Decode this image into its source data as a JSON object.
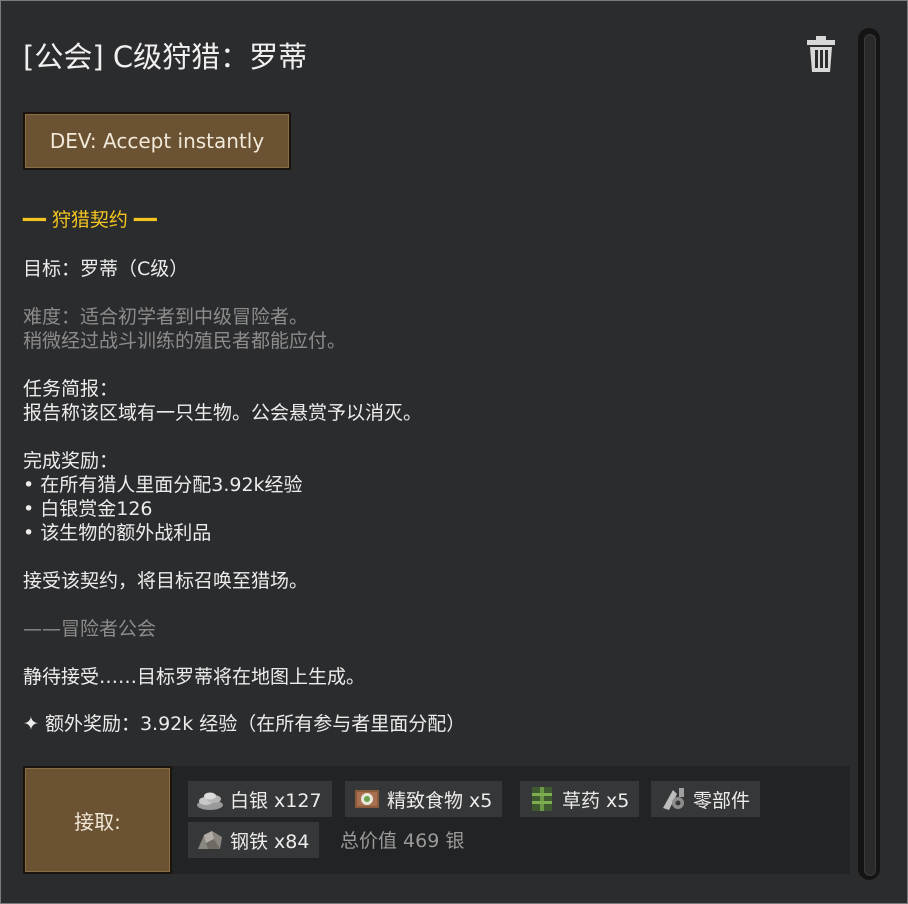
{
  "quest": {
    "title": "[公会] C级狩猎：罗蒂",
    "dev_button": "DEV: Accept instantly",
    "section_header": "━━ 狩猎契约 ━━",
    "target": "目标：罗蒂（C级）",
    "difficulty_line1": " 难度：适合初学者到中级冒险者。",
    "difficulty_line2": "稍微经过战斗训练的殖民者都能应付。",
    "briefing_title": "任务简报：",
    "briefing_text": "报告称该区域有一只生物。公会悬赏予以消灭。",
    "reward_title": "完成奖励：",
    "reward_items": [
      "• 在所有猎人里面分配3.92k经验",
      "• 白银赏金126",
      "• 该生物的额外战利品"
    ],
    "accept_note": "接受该契约，将目标召唤至猎场。",
    "signature": "——冒险者公会",
    "waiting": "静待接受……目标罗蒂将在地图上生成。",
    "bonus": "✦ 额外奖励：3.92k 经验（在所有参与者里面分配）"
  },
  "footer": {
    "accept_button": "接取:",
    "rewards": [
      {
        "label": "白银 x127",
        "icon": "silver-icon"
      },
      {
        "label": "精致食物 x5",
        "icon": "fine-meal-icon"
      },
      {
        "label": "草药 x5",
        "icon": "herbal-medicine-icon"
      },
      {
        "label": "零部件",
        "icon": "components-icon"
      },
      {
        "label": "钢铁 x84",
        "icon": "steel-icon"
      }
    ],
    "total_value": "总价值 469 银"
  },
  "colors": {
    "accent_yellow": "#f4c520",
    "button_brown": "#6b5232",
    "background": "#2b2c2e"
  }
}
